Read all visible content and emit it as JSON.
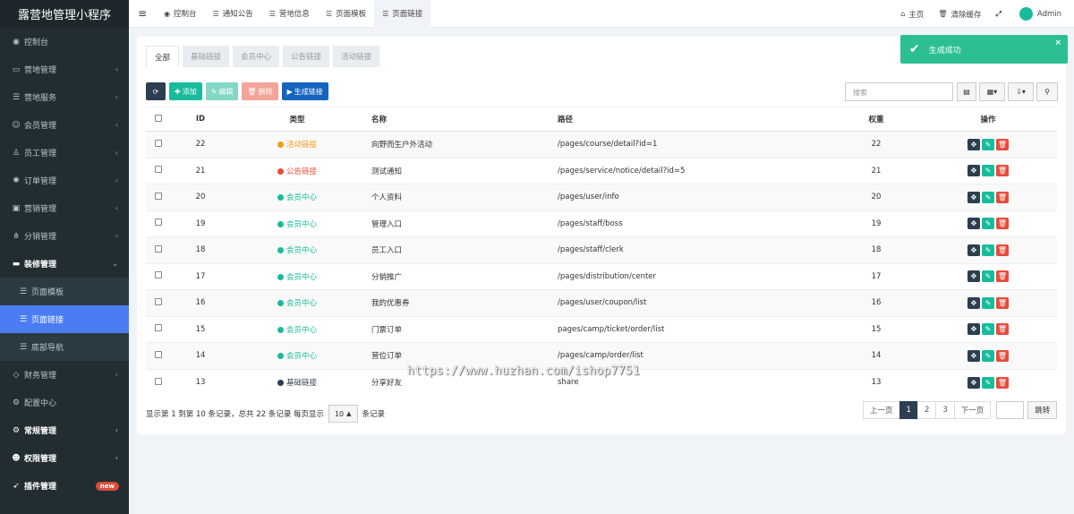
{
  "app": {
    "title": "露营地管理小程序"
  },
  "sidebar": {
    "items": [
      {
        "label": "控制台",
        "icon": "dashboard-icon"
      },
      {
        "label": "营地管理",
        "icon": "map-icon",
        "chevron": "‹"
      },
      {
        "label": "营地服务",
        "icon": "list-icon",
        "chevron": "‹"
      },
      {
        "label": "会员管理",
        "icon": "user-icon",
        "chevron": "‹"
      },
      {
        "label": "员工管理",
        "icon": "staff-icon",
        "chevron": "‹"
      },
      {
        "label": "订单管理",
        "icon": "order-icon",
        "chevron": "‹"
      },
      {
        "label": "营销管理",
        "icon": "marketing-icon",
        "chevron": "‹"
      },
      {
        "label": "分销管理",
        "icon": "sitemap-icon",
        "chevron": "‹"
      },
      {
        "label": "装修管理",
        "icon": "decor-icon",
        "chevron": "⌄"
      },
      {
        "label": "页面模板",
        "icon": "list-icon"
      },
      {
        "label": "页面链接",
        "icon": "list-icon"
      },
      {
        "label": "底部导航",
        "icon": "list-icon"
      },
      {
        "label": "财务管理",
        "icon": "diamond-icon",
        "chevron": "‹"
      },
      {
        "label": "配置中心",
        "icon": "gear-icon"
      },
      {
        "label": "常规管理",
        "icon": "cogs-icon",
        "chevron": "‹"
      },
      {
        "label": "权限管理",
        "icon": "group-icon",
        "chevron": "‹"
      },
      {
        "label": "插件管理",
        "icon": "rocket-icon",
        "badge": "new"
      }
    ]
  },
  "topbar": {
    "menu_icon": "≡",
    "tabs": [
      {
        "label": "控制台",
        "icon": "dashboard-icon"
      },
      {
        "label": "通知公告",
        "icon": "list-icon"
      },
      {
        "label": "营地信息",
        "icon": "list-icon"
      },
      {
        "label": "页面模板",
        "icon": "list-icon"
      },
      {
        "label": "页面链接",
        "icon": "list-icon"
      }
    ],
    "home": "主页",
    "clear_cache": "清除缓存",
    "user": "Admin"
  },
  "content": {
    "filter_tabs": [
      "全部",
      "基础链接",
      "会员中心",
      "公告链接",
      "活动链接"
    ],
    "buttons": {
      "add": "添加",
      "edit": "编辑",
      "delete": "删除",
      "generate": "生成链接"
    },
    "search_placeholder": "搜索",
    "columns": [
      "ID",
      "类型",
      "名称",
      "路径",
      "权重",
      "操作"
    ],
    "rows": [
      {
        "id": "22",
        "type": "活动链接",
        "type_color": "#f39c12",
        "name": "向野而生户外活动",
        "path": "/pages/course/detail?id=1",
        "weight": "22"
      },
      {
        "id": "21",
        "type": "公告链接",
        "type_color": "#e74c3c",
        "name": "测试通知",
        "path": "/pages/service/notice/detail?id=5",
        "weight": "21"
      },
      {
        "id": "20",
        "type": "会员中心",
        "type_color": "#18bc9c",
        "name": "个人资料",
        "path": "/pages/user/info",
        "weight": "20"
      },
      {
        "id": "19",
        "type": "会员中心",
        "type_color": "#18bc9c",
        "name": "管理入口",
        "path": "/pages/staff/boss",
        "weight": "19"
      },
      {
        "id": "18",
        "type": "会员中心",
        "type_color": "#18bc9c",
        "name": "员工入口",
        "path": "/pages/staff/clerk",
        "weight": "18"
      },
      {
        "id": "17",
        "type": "会员中心",
        "type_color": "#18bc9c",
        "name": "分销推广",
        "path": "/pages/distribution/center",
        "weight": "17"
      },
      {
        "id": "16",
        "type": "会员中心",
        "type_color": "#18bc9c",
        "name": "我的优惠券",
        "path": "/pages/user/coupon/list",
        "weight": "16"
      },
      {
        "id": "15",
        "type": "会员中心",
        "type_color": "#18bc9c",
        "name": "门票订单",
        "path": "pages/camp/ticket/order/list",
        "weight": "15"
      },
      {
        "id": "14",
        "type": "会员中心",
        "type_color": "#18bc9c",
        "name": "营位订单",
        "path": "/pages/camp/order/list",
        "weight": "14"
      },
      {
        "id": "13",
        "type": "基础链接",
        "type_color": "#2c3e50",
        "name": "分享好友",
        "path": "share",
        "weight": "13"
      }
    ],
    "footer": {
      "info": "显示第 1 到第 10 条记录，总共 22 条记录 每页显示",
      "page_size": "10",
      "suffix": "条记录"
    },
    "pagination": {
      "prev": "上一页",
      "pages": [
        "1",
        "2",
        "3"
      ],
      "current": "1",
      "next": "下一页",
      "jump": "跳转"
    }
  },
  "toast": {
    "message": "生成成功",
    "close": "×"
  },
  "watermark": "https://www.huzhan.com/ishop7751"
}
